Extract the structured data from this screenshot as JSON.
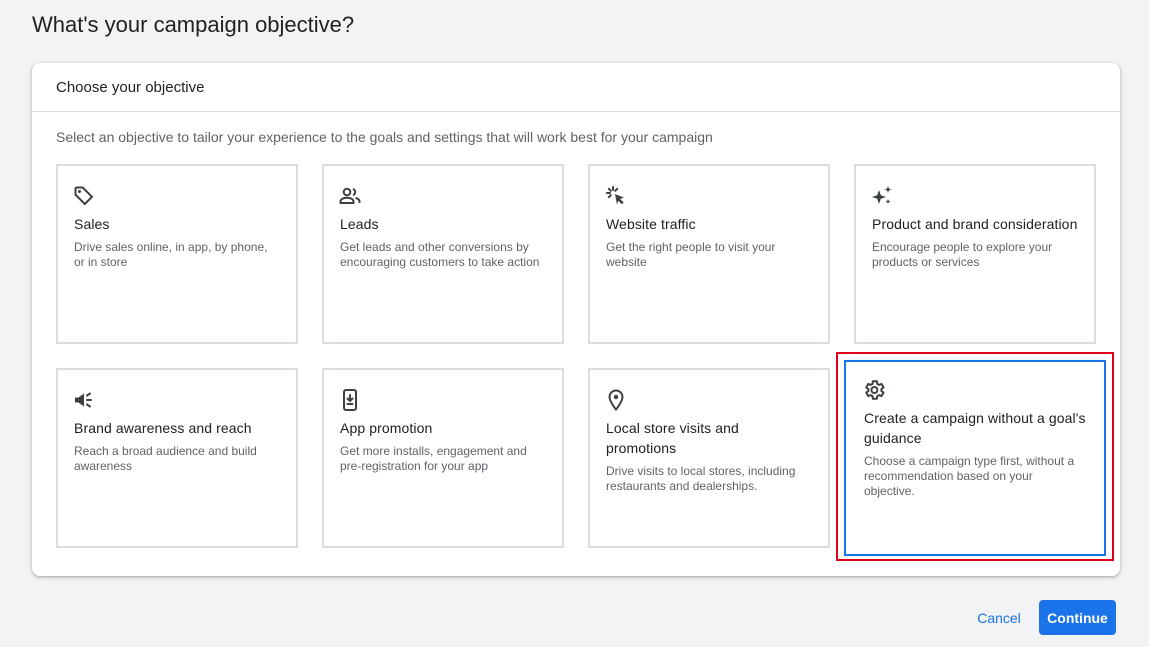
{
  "page": {
    "title": "What's your campaign objective?"
  },
  "panel": {
    "header": "Choose your objective",
    "description": "Select an objective to tailor your experience to the goals and settings that will work best for your campaign"
  },
  "objectives": [
    {
      "icon": "tag-icon",
      "title": "Sales",
      "description": "Drive sales online, in app, by phone, or in store"
    },
    {
      "icon": "people-icon",
      "title": "Leads",
      "description": "Get leads and other conversions by encouraging customers to take action"
    },
    {
      "icon": "cursor-click-icon",
      "title": "Website traffic",
      "description": "Get the right people to visit your website"
    },
    {
      "icon": "sparkle-icon",
      "title": "Product and brand consideration",
      "description": "Encourage people to explore your products or services"
    },
    {
      "icon": "megaphone-icon",
      "title": "Brand awareness and reach",
      "description": "Reach a broad audience and build awareness"
    },
    {
      "icon": "mobile-download-icon",
      "title": "App promotion",
      "description": "Get more installs, engagement and pre-registration for your app"
    },
    {
      "icon": "location-pin-icon",
      "title": "Local store visits and promotions",
      "description": "Drive visits to local stores, including restaurants and dealerships."
    },
    {
      "icon": "gear-icon",
      "title": "Create a campaign without a goal's guidance",
      "description": "Choose a campaign type first, without a recommendation based on your objective.",
      "selected": true
    }
  ],
  "actions": {
    "cancel_label": "Cancel",
    "continue_label": "Continue"
  },
  "colors": {
    "accent": "#1a73e8",
    "highlight": "#e0001b",
    "background": "#f1f3f4"
  }
}
